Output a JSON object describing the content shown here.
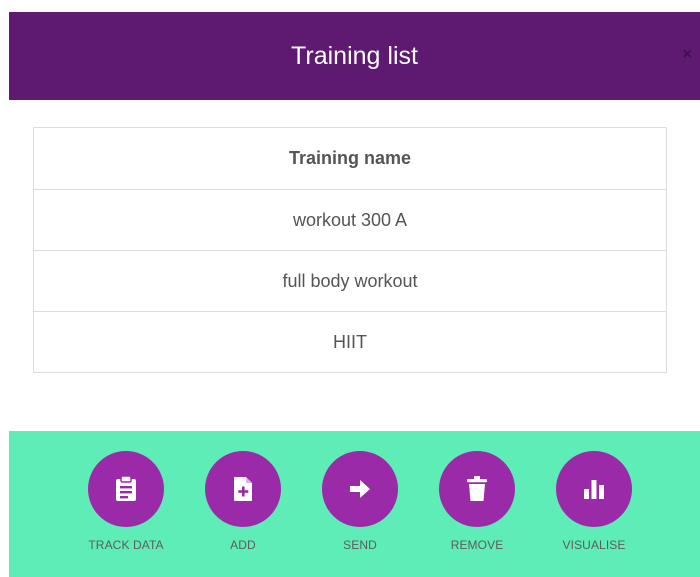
{
  "header": {
    "title": "Training list",
    "close_symbol": "×"
  },
  "table": {
    "header": "Training name",
    "rows": [
      "workout 300 A",
      "full body workout",
      "HIIT"
    ]
  },
  "actions": [
    {
      "label": "TRACK DATA",
      "icon": "clipboard-icon"
    },
    {
      "label": "ADD",
      "icon": "add-file-icon"
    },
    {
      "label": "SEND",
      "icon": "arrow-right-icon"
    },
    {
      "label": "REMOVE",
      "icon": "trash-icon"
    },
    {
      "label": "VISUALISE",
      "icon": "bar-chart-icon"
    }
  ],
  "colors": {
    "header_bg": "#5d1a70",
    "footer_bg": "#5eedb6",
    "action_circle": "#9b2aa8"
  }
}
